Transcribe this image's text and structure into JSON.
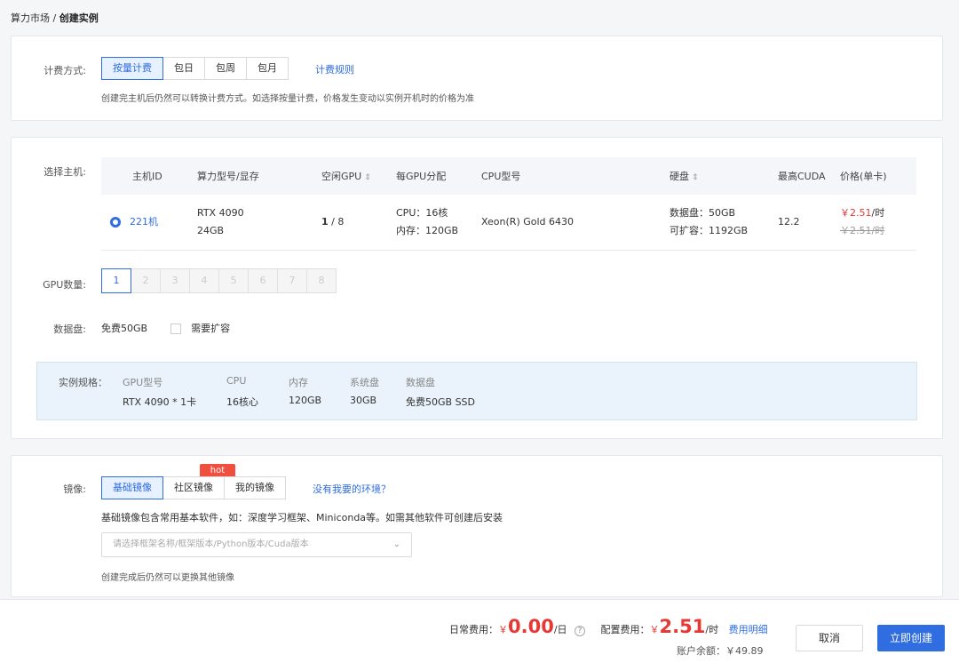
{
  "breadcrumb": {
    "parent": "算力市场",
    "sep": "/",
    "current": "创建实例"
  },
  "billing": {
    "label": "计费方式:",
    "options": [
      "按量计费",
      "包日",
      "包周",
      "包月"
    ],
    "selected": "按量计费",
    "rules_link": "计费规则",
    "hint": "创建完主机后仍然可以转换计费方式。如选择按量计费，价格发生变动以实例开机时的价格为准"
  },
  "host": {
    "label": "选择主机:",
    "columns": [
      "主机ID",
      "算力型号/显存",
      "空闲GPU",
      "每GPU分配",
      "CPU型号",
      "硬盘",
      "最高CUDA",
      "价格(单卡)"
    ],
    "sort_icon": "⇕",
    "row": {
      "id": "221机",
      "gpu_model": "RTX 4090",
      "gpu_mem": "24GB",
      "free_gpu": "1",
      "total_gpu": "/ 8",
      "cpu_alloc": "CPU：16核",
      "mem_alloc": "内存：120GB",
      "cpu_model": "Xeon(R) Gold 6430",
      "disk_data": "数据盘：50GB",
      "disk_expand": "可扩容：1192GB",
      "cuda": "12.2",
      "price": "￥2.51",
      "price_unit": "/时",
      "price_old": "￥2.51/时"
    }
  },
  "gpu_count": {
    "label": "GPU数量:",
    "options": [
      "1",
      "2",
      "3",
      "4",
      "5",
      "6",
      "7",
      "8"
    ],
    "selected": "1"
  },
  "data_disk": {
    "label": "数据盘:",
    "free": "免费50GB",
    "expand_label": "需要扩容",
    "expand_checked": false
  },
  "spec": {
    "label": "实例规格：",
    "headers": [
      "GPU型号",
      "CPU",
      "内存",
      "系统盘",
      "数据盘"
    ],
    "values": [
      "RTX 4090 * 1卡",
      "16核心",
      "120GB",
      "30GB",
      "免费50GB SSD"
    ]
  },
  "image": {
    "label": "镜像:",
    "tabs": [
      "基础镜像",
      "社区镜像",
      "我的镜像"
    ],
    "selected": "基础镜像",
    "hot_badge": "hot",
    "missing_link": "没有我要的环境？",
    "desc": "基础镜像包含常用基本软件，如：深度学习框架、Miniconda等。如需其他软件可创建后安装",
    "select_placeholder": "请选择框架名称/框架版本/Python版本/Cuda版本",
    "footer_hint": "创建完成后仍然可以更换其他镜像"
  },
  "footer": {
    "daily_label": "日常费用：",
    "currency": "￥",
    "daily_amount": "0.00",
    "daily_unit": "/日",
    "help_icon": "?",
    "config_label": "配置费用：",
    "config_amount": "2.51",
    "config_unit": "/时",
    "detail_link": "费用明细",
    "balance_label": "账户余额：",
    "balance": "￥49.89",
    "cancel": "取消",
    "create": "立即创建"
  },
  "colors": {
    "primary": "#2f6de1",
    "price_red": "#e53935",
    "hot": "#f04e3e"
  }
}
